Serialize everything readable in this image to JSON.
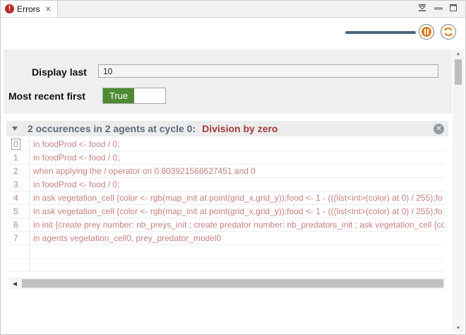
{
  "tab": {
    "title": "Errors",
    "icon": "error-icon",
    "close_glyph": "⨯"
  },
  "window_controls": {
    "dropdown_icon": "view-menu-icon",
    "minimize_icon": "minimize-icon",
    "maximize_icon": "maximize-icon"
  },
  "toolbar": {
    "progress_fraction": 1.0,
    "pause_icon": "pause-icon",
    "refresh_icon": "refresh-icon",
    "accent_color": "#e07a1a"
  },
  "settings": {
    "display_last_label": "Display last",
    "display_last_value": "10",
    "most_recent_first_label": "Most recent first",
    "most_recent_first_state": "True",
    "toggle_color": "#4c8a33"
  },
  "group": {
    "summary": "2 occurences in 2 agents at cycle 0:",
    "error": "Division by zero",
    "error_color": "#a33b3b",
    "close_icon": "close-icon"
  },
  "trace": [
    {
      "num": "0",
      "text": "in foodProd <- food / 0;"
    },
    {
      "num": "1",
      "text": "in foodProd <- food / 0;"
    },
    {
      "num": "2",
      "text": "when applying the / operator on 0.803921568627451 and 0"
    },
    {
      "num": "3",
      "text": "in foodProd <- food / 0;"
    },
    {
      "num": "4",
      "text": "in ask vegetation_cell  {color <- rgb(map_init at point(grid_x,grid_y));food <- 1 - (((list<int>(color) at 0) / 255);fo"
    },
    {
      "num": "5",
      "text": "in ask vegetation_cell  {color <- rgb(map_init at point(grid_x,grid_y));food <- 1 - (((list<int>(color) at 0) / 255);fo"
    },
    {
      "num": "6",
      "text": "in init  {create prey number: nb_preys_init ; create predator number: nb_predators_init ; ask vegetation_cell  {col"
    },
    {
      "num": "7",
      "text": "in agents vegetation_cell0, prey_predator_model0"
    }
  ]
}
